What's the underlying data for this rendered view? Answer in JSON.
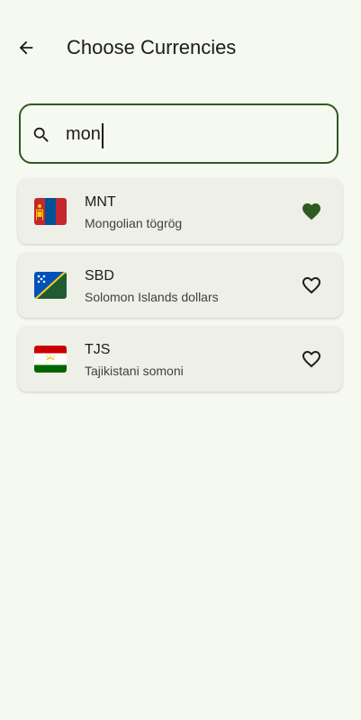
{
  "header": {
    "title": "Choose Currencies",
    "back_icon": "arrow-back-icon"
  },
  "search": {
    "value": "mon",
    "placeholder": "",
    "icon": "search-icon"
  },
  "colors": {
    "accent": "#2f5a22",
    "background": "#f6f9ef",
    "card": "#eef0e8"
  },
  "currencies": [
    {
      "code": "MNT",
      "name": "Mongolian tögrög",
      "flag": "mongolia-flag-icon",
      "favorite": true
    },
    {
      "code": "SBD",
      "name": "Solomon Islands dollars",
      "flag": "solomon-islands-flag-icon",
      "favorite": false
    },
    {
      "code": "TJS",
      "name": "Tajikistani somoni",
      "flag": "tajikistan-flag-icon",
      "favorite": false
    }
  ]
}
